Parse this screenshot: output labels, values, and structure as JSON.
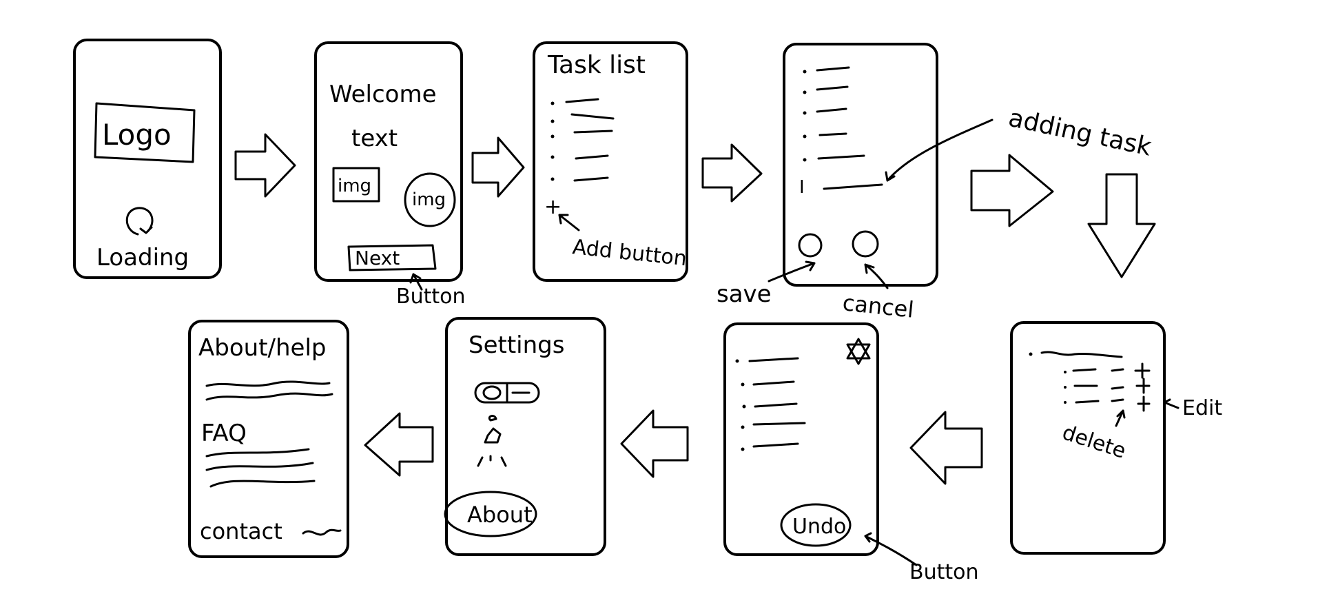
{
  "screens": {
    "loading": {
      "logo": "Logo",
      "status": "Loading"
    },
    "welcome": {
      "title_line1": "Welcome",
      "title_line2": "text",
      "img_square": "img",
      "img_circle": "img",
      "next": "Next",
      "annotation": "Button"
    },
    "task_list": {
      "title": "Task list",
      "plus": "+",
      "annotation": "Add button"
    },
    "adding": {
      "cursor": "I",
      "annotation_task": "adding task",
      "annotation_save": "save",
      "annotation_cancel": "cancel"
    },
    "edit_delete": {
      "annotation_edit": "Edit",
      "annotation_delete": "delete"
    },
    "undo": {
      "undo": "Undo",
      "annotation": "Button"
    },
    "settings": {
      "title": "Settings",
      "about": "About"
    },
    "about_help": {
      "title": "About/help",
      "faq": "FAQ",
      "contact": "contact"
    }
  }
}
